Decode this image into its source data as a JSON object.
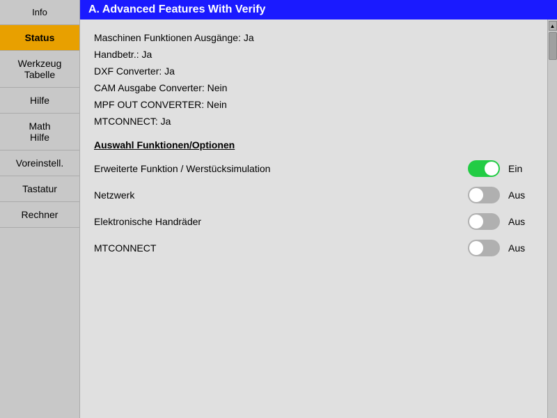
{
  "sidebar": {
    "items": [
      {
        "id": "info",
        "label": "Info",
        "active": false,
        "multiline": false
      },
      {
        "id": "status",
        "label": "Status",
        "active": true,
        "multiline": false
      },
      {
        "id": "werkzeug-tabelle",
        "label": "Werkzeug\nTabelle",
        "active": false,
        "multiline": true
      },
      {
        "id": "hilfe",
        "label": "Hilfe",
        "active": false,
        "multiline": false
      },
      {
        "id": "math-hilfe",
        "label": "Math\nHilfe",
        "active": false,
        "multiline": true
      },
      {
        "id": "voreinstell",
        "label": "Voreinstell.",
        "active": false,
        "multiline": false
      },
      {
        "id": "tastatur",
        "label": "Tastatur",
        "active": false,
        "multiline": false
      },
      {
        "id": "rechner",
        "label": "Rechner",
        "active": false,
        "multiline": false
      }
    ]
  },
  "header": {
    "title": "A.  Advanced Features With Verify"
  },
  "info_lines": [
    "Maschinen Funktionen Ausgänge: Ja",
    "Handbetr.: Ja",
    "DXF Converter: Ja",
    "CAM Ausgabe Converter: Nein",
    "MPF  OUT CONVERTER: Nein",
    "MTCONNECT: Ja"
  ],
  "section_title": "Auswahl Funktionen/Optionen",
  "toggles": [
    {
      "id": "erweiterte-funktion",
      "label": "Erweiterte Funktion / Werstücksimulation",
      "state": "on",
      "status_label_on": "Ein",
      "status_label_off": "Aus",
      "current_status": "Ein"
    },
    {
      "id": "netzwerk",
      "label": "Netzwerk",
      "state": "off",
      "status_label_on": "Ein",
      "status_label_off": "Aus",
      "current_status": "Aus"
    },
    {
      "id": "elektronische-handraeder",
      "label": "Elektronische Handräder",
      "state": "off",
      "status_label_on": "Ein",
      "status_label_off": "Aus",
      "current_status": "Aus"
    },
    {
      "id": "mtconnect",
      "label": "MTCONNECT",
      "state": "off",
      "status_label_on": "Ein",
      "status_label_off": "Aus",
      "current_status": "Aus"
    }
  ]
}
